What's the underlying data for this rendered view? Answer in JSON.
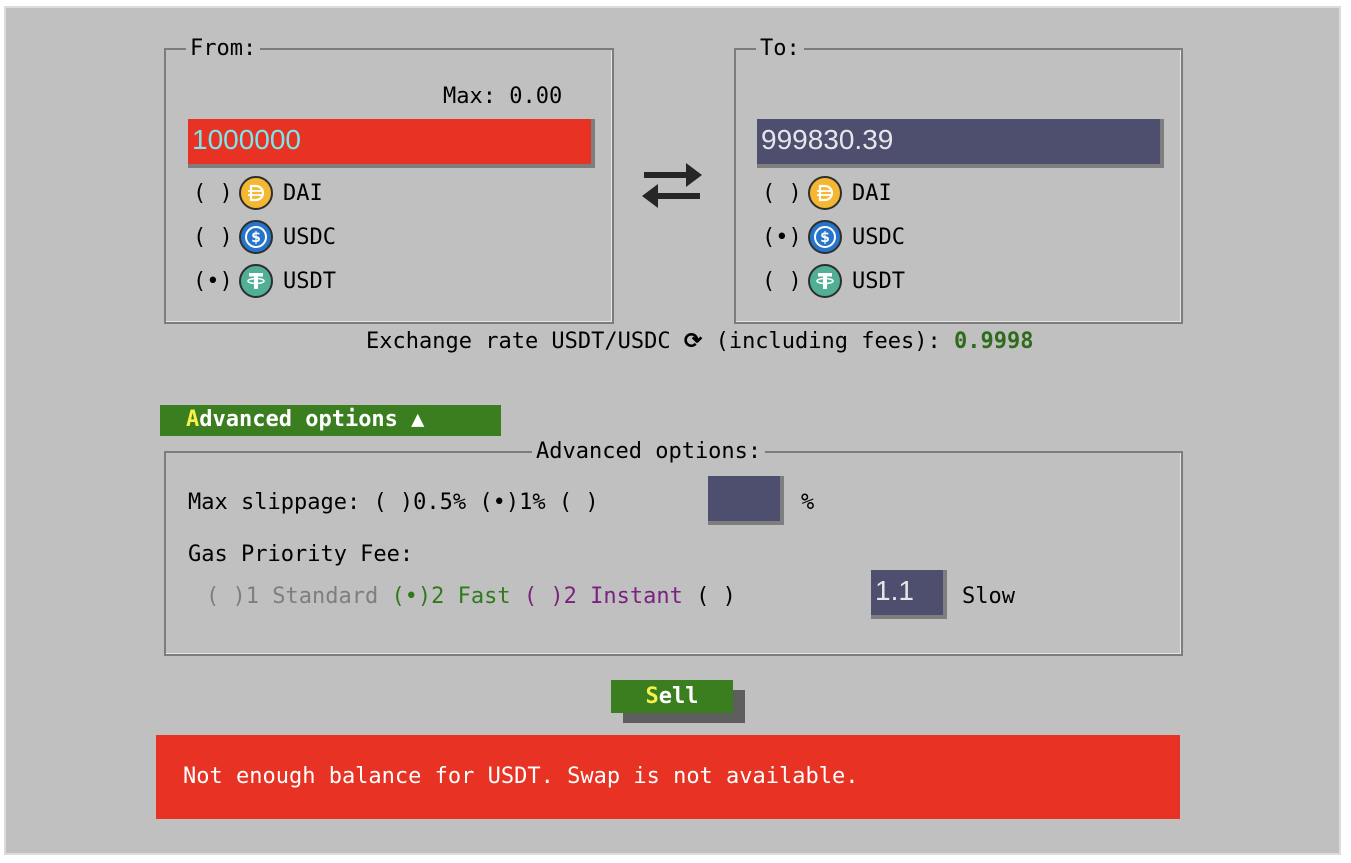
{
  "from": {
    "legend": "From:",
    "max_label": "Max: 0.00",
    "amount_value": "1000000",
    "coins": [
      {
        "radio": "( )",
        "name": "DAI",
        "icon": "dai-coin-icon"
      },
      {
        "radio": "( )",
        "name": "USDC",
        "icon": "usdc-coin-icon"
      },
      {
        "radio": "(•)",
        "name": "USDT",
        "icon": "usdt-coin-icon"
      }
    ]
  },
  "to": {
    "legend": "To:",
    "amount_value": "999830.39",
    "coins": [
      {
        "radio": "( )",
        "name": "DAI",
        "icon": "dai-coin-icon"
      },
      {
        "radio": "(•)",
        "name": "USDC",
        "icon": "usdc-coin-icon"
      },
      {
        "radio": "( )",
        "name": "USDT",
        "icon": "usdt-coin-icon"
      }
    ]
  },
  "swap_icon": "swap-arrows-icon",
  "exchange": {
    "label_before": "Exchange rate USDT/USDC ",
    "refresh_icon": "refresh-icon",
    "label_after": " (including fees): ",
    "rate": "0.9998"
  },
  "advanced_toggle": {
    "hotkey": "A",
    "rest": "dvanced options ▲"
  },
  "advanced": {
    "legend": "Advanced options:",
    "slippage_label": "Max slippage: ",
    "slippage_opt1": "( )0.5%",
    "slippage_opt2": "(•)1%",
    "slippage_opt3": "( )",
    "slippage_custom_value": "",
    "percent_sign": "%",
    "gas_label": "Gas Priority Fee:",
    "gas_standard": "( )1 Standard",
    "gas_fast": "(•)2 Fast",
    "gas_instant": "( )2 Instant",
    "gas_custom_radio": "( )",
    "gas_custom_value": "1.1",
    "gas_slow_label": "Slow"
  },
  "sell_button": {
    "hotkey": "S",
    "rest": "ell"
  },
  "error_message": "Not enough balance for USDT. Swap is not available.",
  "colors": {
    "background": "#c0c0c0",
    "accent_green": "#3a7e1f",
    "error_red": "#e83223",
    "input_dark": "#4e4e6e",
    "rate_green": "#2f6b1d",
    "instant_purple": "#7b2180"
  }
}
